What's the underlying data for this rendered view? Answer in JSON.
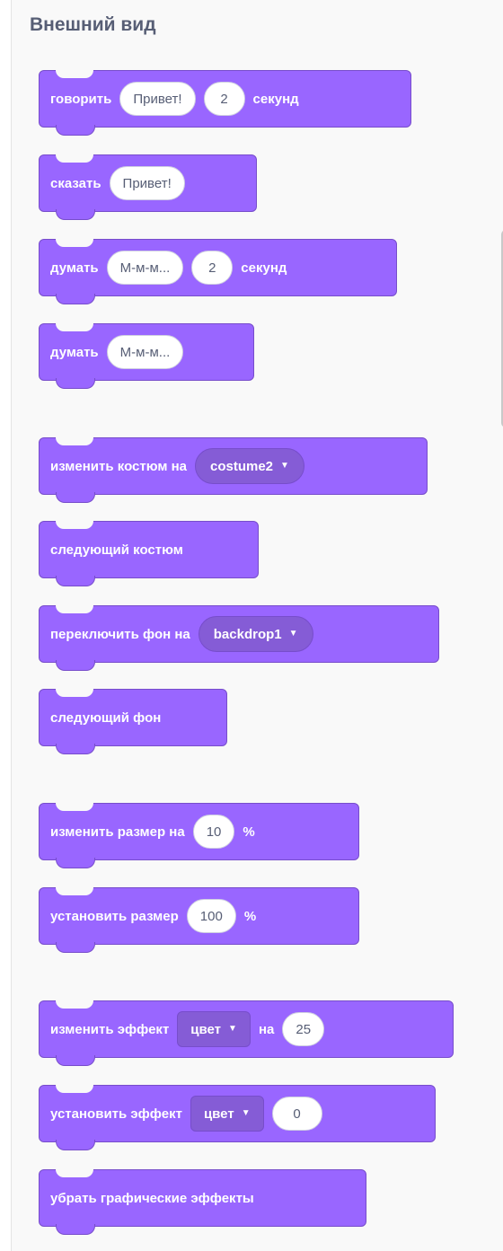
{
  "category_title": "Внешний вид",
  "colors": {
    "block": "#9966ff",
    "block_border": "#774dcb",
    "dropdown": "#855cd6",
    "text_dark": "#575e75"
  },
  "blocks": {
    "say_for_secs": {
      "label": "говорить",
      "message": "Привет!",
      "secs": "2",
      "secs_label": "секунд"
    },
    "say": {
      "label": "сказать",
      "message": "Привет!"
    },
    "think_for_secs": {
      "label": "думать",
      "message": "М-м-м...",
      "secs": "2",
      "secs_label": "секунд"
    },
    "think": {
      "label": "думать",
      "message": "М-м-м..."
    },
    "switch_costume": {
      "label": "изменить костюм на",
      "value": "costume2"
    },
    "next_costume": {
      "label": "следующий костюм"
    },
    "switch_backdrop": {
      "label": "переключить фон на",
      "value": "backdrop1"
    },
    "next_backdrop": {
      "label": "следующий фон"
    },
    "change_size": {
      "label": "изменить размер на",
      "value": "10",
      "unit": "%"
    },
    "set_size": {
      "label": "установить размер",
      "value": "100",
      "unit": "%"
    },
    "change_effect": {
      "label": "изменить эффект",
      "effect": "цвет",
      "by_label": "на",
      "value": "25"
    },
    "set_effect": {
      "label": "установить эффект",
      "effect": "цвет",
      "value": "0"
    },
    "clear_effects": {
      "label": "убрать графические эффекты"
    }
  },
  "icons": {
    "dropdown": "caret-down-icon"
  }
}
